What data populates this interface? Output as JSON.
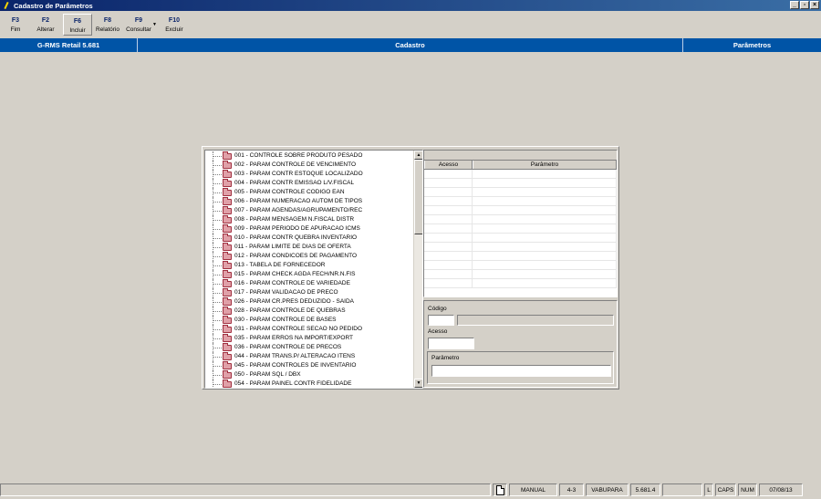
{
  "window": {
    "title": "Cadastro de Parâmetros",
    "buttons": [
      "_",
      "▫",
      "×"
    ]
  },
  "toolbar": [
    {
      "key": "F3",
      "label": "Fim"
    },
    {
      "key": "F2",
      "label": "Alterar"
    },
    {
      "key": "F6",
      "label": "Incluir"
    },
    {
      "key": "F8",
      "label": "Relatório"
    },
    {
      "key": "F9",
      "label": "Consultar"
    },
    {
      "key": "F10",
      "label": "Excluir"
    }
  ],
  "header": {
    "left": "G-RMS Retail 5.681",
    "center": "Cadastro",
    "right": "Parâmetros"
  },
  "tree": {
    "items": [
      "001 - CONTROLE SOBRE PRODUTO PESADO",
      "002 - PARAM CONTROLE DE VENCIMENTO",
      "003 - PARAM CONTR ESTOQUE LOCALIZADO",
      "004 - PARAM CONTR EMISSAO L/V.FISCAL",
      "005 - PARAM CONTROLE CODIGO EAN",
      "006 - PARAM NUMERACAO AUTOM DE TIPOS",
      "007 - PARAM AGENDAS/AGRUPAMENTO/REC",
      "008 - PARAM MENSAGEM N.FISCAL DISTR",
      "009 - PARAM PERIODO DE APURACAO ICMS",
      "010 - PARAM CONTR QUEBRA INVENTARIO",
      "011 - PARAM LIMITE DE DIAS DE OFERTA",
      "012 - PARAM CONDICOES DE PAGAMENTO",
      "013 - TABELA DE FORNECEDOR",
      "015 - PARAM CHECK AGDA FECH/NR.N.FIS",
      "016 - PARAM CONTROLE DE VARIEDADE",
      "017 - PARAM VALIDACAO DE PRECO",
      "026 - PARAM CR.PRES DEDUZIDO - SAIDA",
      "028 - PARAM CONTROLE DE QUEBRAS",
      "030 - PARAM CONTROLE DE BASES",
      "031 - PARAM CONTROLE SECAO NO PEDIDO",
      "035 - PARAM ERROS NA IMPORT/EXPORT",
      "036 - PARAM CONTROLE DE PRECOS",
      "044 - PARAM TRANS.P/ ALTERACAO ITENS",
      "045 - PARAM CONTROLES DE INVENTARIO",
      "050 - PARAM SQL / DBX",
      "054 - PARAM PAINEL CONTR FIDELIDADE"
    ]
  },
  "grid": {
    "columns": [
      "Acesso",
      "Parâmetro"
    ]
  },
  "form": {
    "codigo_label": "Código",
    "acesso_label": "Acesso",
    "parametro_label": "Parâmetro"
  },
  "status": {
    "mode": "MANUAL",
    "code": "4-3",
    "user": "VABUPARA",
    "version": "5.681.4",
    "l": "L",
    "caps": "CAPS",
    "num": "NUM",
    "date": "07/08/13"
  }
}
